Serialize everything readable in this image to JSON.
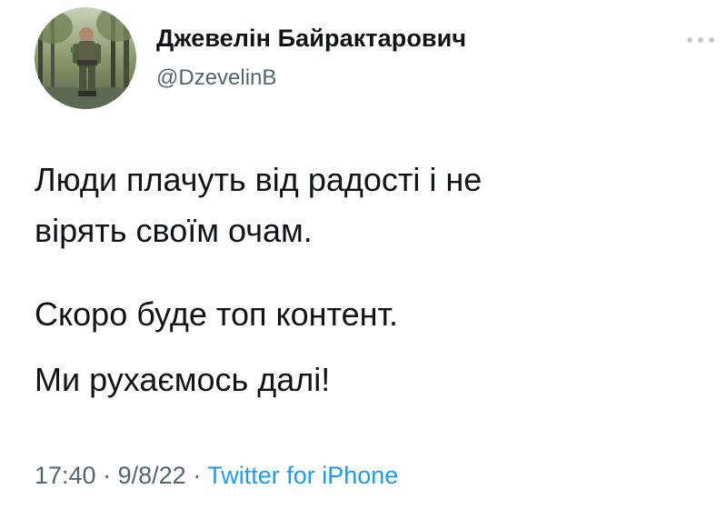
{
  "author": {
    "display_name": "Джевелін Байрактарович",
    "handle": "@DzevelinB"
  },
  "menu": {
    "icon": "more-horizontal-icon"
  },
  "tweet": {
    "paragraph_1_line_1": "Люди плачуть від радості і не",
    "paragraph_1_line_2": "вірять своїм очам.",
    "paragraph_2": "Скоро буде топ контент.",
    "paragraph_3": "Ми рухаємось далі!"
  },
  "meta": {
    "time": "17:40",
    "separator": "·",
    "date": "9/8/22",
    "source": "Twitter for iPhone"
  },
  "colors": {
    "text": "#0f1419",
    "secondary": "#536471",
    "link": "#1d9bf0"
  }
}
